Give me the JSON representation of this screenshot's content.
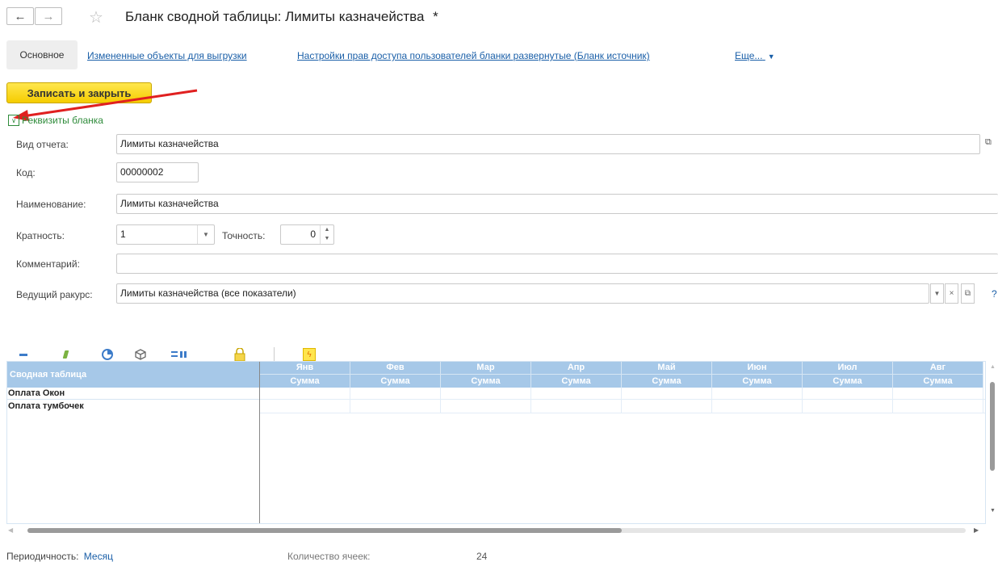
{
  "window": {
    "title": "Бланк сводной таблицы: Лимиты казначейства",
    "modified_mark": "*"
  },
  "tabs": [
    {
      "label": "Основное"
    },
    {
      "label": "Измененные объекты для выгрузки"
    },
    {
      "label": "Настройки прав доступа пользователей бланки развернутые (Бланк источник)"
    },
    {
      "label": "Еще..."
    }
  ],
  "actions": {
    "save_close": "Записать и закрыть"
  },
  "group": {
    "label": "Реквизиты бланка"
  },
  "form": {
    "report_type_label": "Вид отчета:",
    "report_type_value": "Лимиты казначейства",
    "code_label": "Код:",
    "code_value": "00000002",
    "name_label": "Наименование:",
    "name_value": "Лимиты казначейства",
    "multiplicity_label": "Кратность:",
    "multiplicity_value": "1",
    "precision_label": "Точность:",
    "precision_value": "0",
    "comment_label": "Комментарий:",
    "comment_value": "",
    "perspective_label": "Ведущий ракурс:",
    "perspective_value": "Лимиты казначейства (все показатели)"
  },
  "grid": {
    "corner_label": "Сводная таблица",
    "sub_label": "Сумма",
    "months": [
      "Янв",
      "Фев",
      "Мар",
      "Апр",
      "Май",
      "Июн",
      "Июл",
      "Авг"
    ],
    "rows": [
      "Оплата Окон",
      "Оплата тумбочек"
    ]
  },
  "footer": {
    "periodicity_label": "Периодичность:",
    "periodicity_value": "Месяц",
    "cells_label": "Количество ячеек:",
    "cells_value": "24"
  },
  "colors": {
    "accent_link": "#1a5fa8",
    "group_green": "#2e8b3a",
    "grid_header": "#a6c8e8",
    "save_button": "#f5cc00",
    "annotation_arrow": "#e02020"
  }
}
